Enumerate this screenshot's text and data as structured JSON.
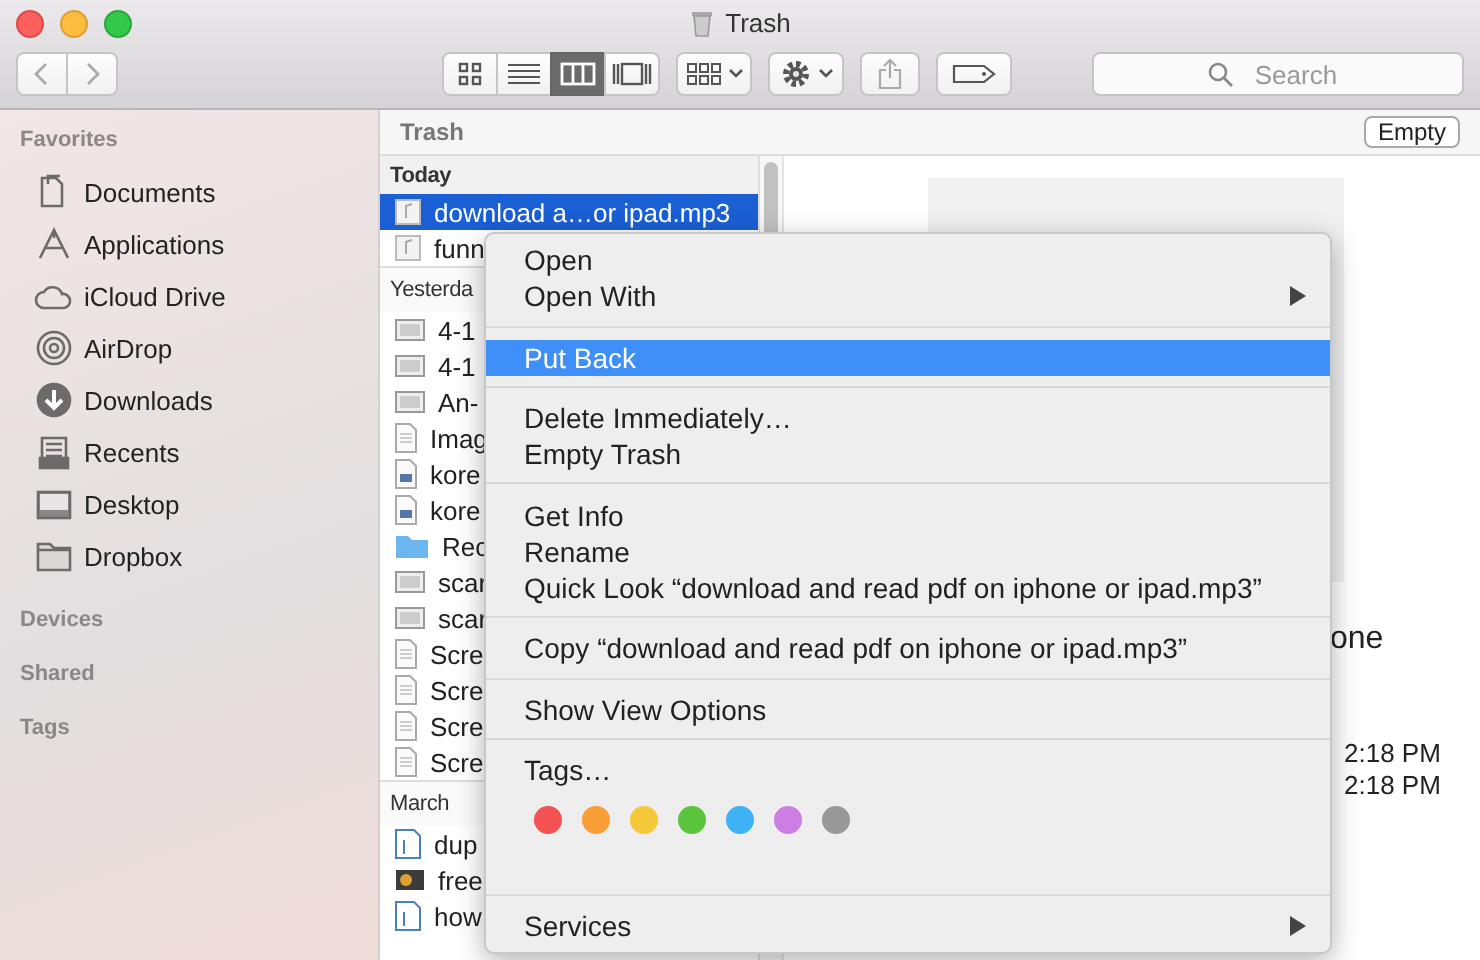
{
  "window": {
    "title": "Trash"
  },
  "toolbar": {
    "view_modes": [
      {
        "kind": "icons",
        "selected": false
      },
      {
        "kind": "list",
        "selected": false
      },
      {
        "kind": "columns",
        "selected": true
      },
      {
        "kind": "gallery",
        "selected": false
      }
    ],
    "search": {
      "placeholder": "Search"
    }
  },
  "sidebar": {
    "sections": [
      {
        "title": "Favorites",
        "items": [
          {
            "label": "Documents",
            "kind": "documents"
          },
          {
            "label": "Applications",
            "kind": "applications"
          },
          {
            "label": "iCloud Drive",
            "kind": "cloud"
          },
          {
            "label": "AirDrop",
            "kind": "airdrop"
          },
          {
            "label": "Downloads",
            "kind": "downloads"
          },
          {
            "label": "Recents",
            "kind": "recents"
          },
          {
            "label": "Desktop",
            "kind": "desktop"
          },
          {
            "label": "Dropbox",
            "kind": "folder"
          }
        ]
      },
      {
        "title": "Devices"
      },
      {
        "title": "Shared"
      },
      {
        "title": "Tags"
      }
    ]
  },
  "path_bar": {
    "title": "Trash",
    "button": "Empty"
  },
  "file_list": {
    "groups": [
      {
        "title": "Today",
        "files": [
          {
            "name": "download a…or ipad.mp3",
            "kind": "audio",
            "selected": true
          },
          {
            "name": "funn",
            "kind": "audio",
            "selected": false
          }
        ]
      },
      {
        "title": "Yesterda",
        "files": [
          {
            "name": "4-1",
            "kind": "image",
            "selected": false
          },
          {
            "name": "4-1",
            "kind": "image",
            "selected": false
          },
          {
            "name": "An-",
            "kind": "image",
            "selected": false
          },
          {
            "name": "Imag",
            "kind": "document",
            "selected": false
          },
          {
            "name": "kore",
            "kind": "script",
            "selected": false
          },
          {
            "name": "kore",
            "kind": "script",
            "selected": false
          },
          {
            "name": "Rec",
            "kind": "folder",
            "selected": false
          },
          {
            "name": "scar",
            "kind": "image",
            "selected": false
          },
          {
            "name": "scar",
            "kind": "image",
            "selected": false
          },
          {
            "name": "Scre",
            "kind": "document",
            "selected": false
          },
          {
            "name": "Scre",
            "kind": "document",
            "selected": false
          },
          {
            "name": "Scre",
            "kind": "document",
            "selected": false
          },
          {
            "name": "Scre",
            "kind": "document",
            "selected": false
          }
        ]
      },
      {
        "title": "March",
        "files": [
          {
            "name": "dup",
            "kind": "text",
            "selected": false
          },
          {
            "name": "free",
            "kind": "photo",
            "selected": false
          },
          {
            "name": "how",
            "kind": "text",
            "selected": false
          }
        ]
      }
    ]
  },
  "preview": {
    "name_fragment": "one",
    "dates": [
      "2:18 PM",
      "2:18 PM"
    ]
  },
  "context_menu": {
    "items": [
      {
        "kind": "item",
        "label": "Open",
        "selected": false
      },
      {
        "kind": "submenu",
        "label": "Open With",
        "selected": false
      },
      {
        "kind": "separator"
      },
      {
        "kind": "item",
        "label": "Put Back",
        "selected": true
      },
      {
        "kind": "separator"
      },
      {
        "kind": "item",
        "label": "Delete Immediately…",
        "selected": false
      },
      {
        "kind": "item",
        "label": "Empty Trash",
        "selected": false
      },
      {
        "kind": "separator"
      },
      {
        "kind": "item",
        "label": "Get Info",
        "selected": false
      },
      {
        "kind": "item",
        "label": "Rename",
        "selected": false
      },
      {
        "kind": "item",
        "label": "Quick Look “download and read pdf on iphone or ipad.mp3”",
        "selected": false
      },
      {
        "kind": "separator"
      },
      {
        "kind": "item",
        "label": "Copy “download and read pdf on iphone or ipad.mp3”",
        "selected": false
      },
      {
        "kind": "separator"
      },
      {
        "kind": "item",
        "label": "Show View Options",
        "selected": false
      },
      {
        "kind": "separator"
      },
      {
        "kind": "item",
        "label": "Tags…",
        "selected": false
      },
      {
        "kind": "tags",
        "tags": [
          {
            "color": "#f25352"
          },
          {
            "color": "#f99d35"
          },
          {
            "color": "#f5c83a"
          },
          {
            "color": "#5ac43b"
          },
          {
            "color": "#3fb1f5"
          },
          {
            "color": "#cd7ee4"
          },
          {
            "color": "#989898"
          }
        ]
      },
      {
        "kind": "separator"
      },
      {
        "kind": "submenu",
        "label": "Services",
        "selected": false
      }
    ]
  }
}
